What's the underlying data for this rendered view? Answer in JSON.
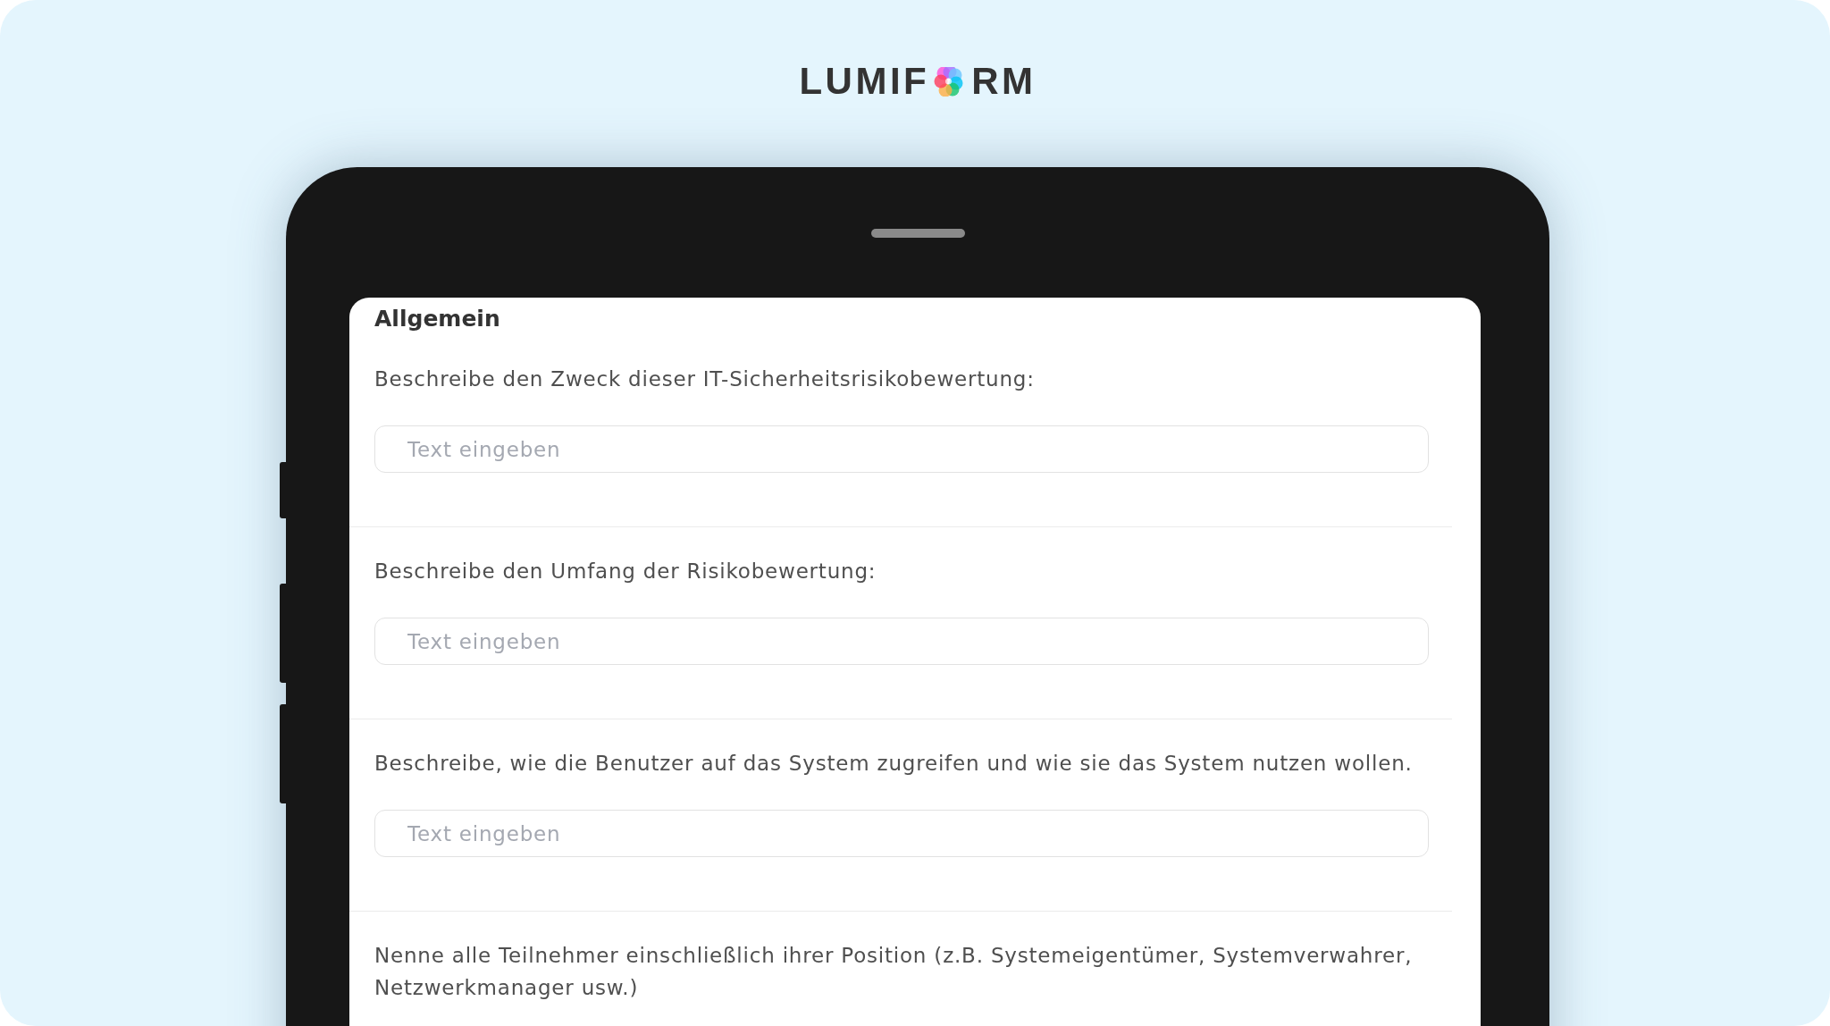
{
  "logo": {
    "wordmark_start": "LUMIF",
    "wordmark_end": "RM"
  },
  "form": {
    "section_title": "Allgemein",
    "questions": [
      {
        "label": "Beschreibe den Zweck dieser IT-Sicherheitsrisikobewertung:",
        "placeholder": "Text eingeben"
      },
      {
        "label": "Beschreibe den Umfang der Risikobewertung:",
        "placeholder": "Text eingeben"
      },
      {
        "label": "Beschreibe, wie die Benutzer auf das System zugreifen und wie sie das System nutzen wollen.",
        "placeholder": "Text eingeben"
      },
      {
        "label": "Nenne alle Teilnehmer einschließlich ihrer Position (z.B. Systemeigentümer, Systemverwahrer, Netzwerkmanager usw.)"
      }
    ]
  }
}
